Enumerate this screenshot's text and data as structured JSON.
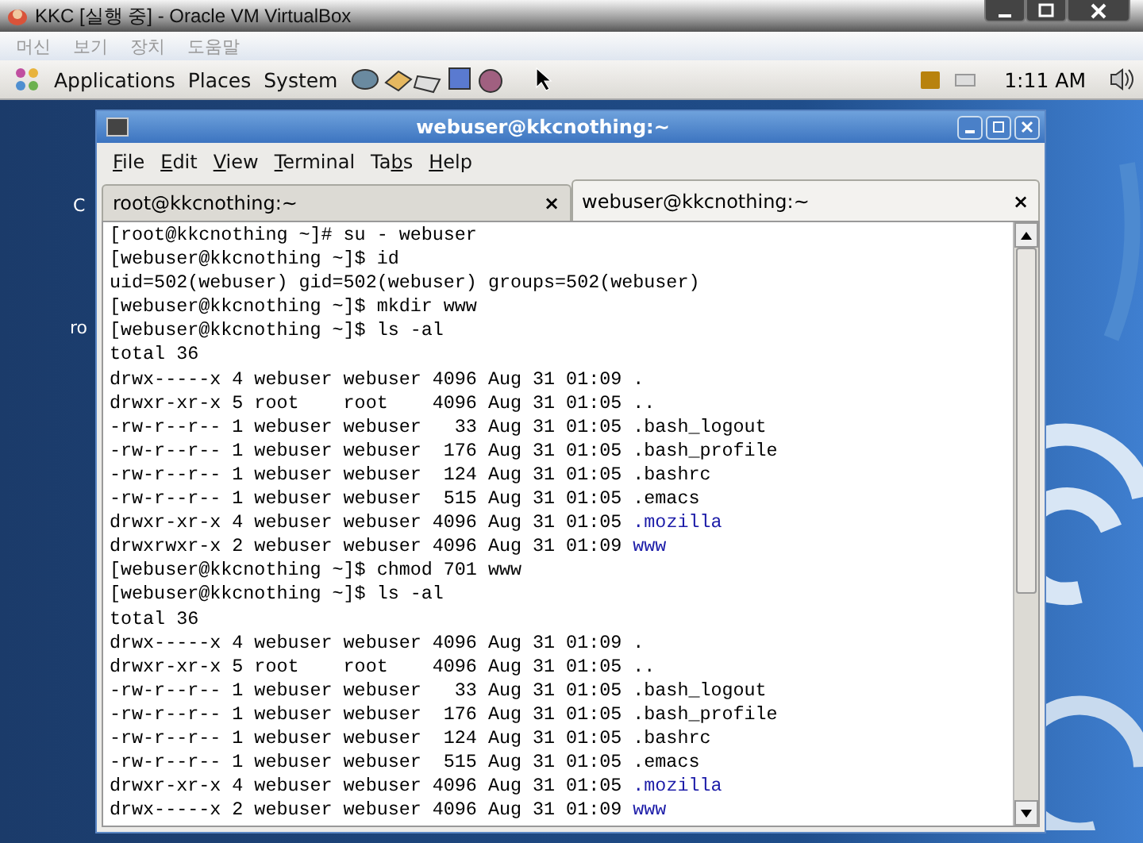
{
  "host_window": {
    "title": "KKC [실행 중] - Oracle VM VirtualBox",
    "menu": [
      "머신",
      "보기",
      "장치",
      "도움말"
    ]
  },
  "panel": {
    "menus": [
      "Applications",
      "Places",
      "System"
    ],
    "clock": "1:11 AM"
  },
  "desktop_labels": [
    "C",
    "ro"
  ],
  "terminal": {
    "title": "webuser@kkcnothing:~",
    "menu": [
      {
        "key": "F",
        "rest": "ile"
      },
      {
        "key": "E",
        "rest": "dit"
      },
      {
        "key": "V",
        "rest": "iew"
      },
      {
        "key": "T",
        "rest": "erminal"
      },
      {
        "pre": "Ta",
        "key": "b",
        "rest": "s"
      },
      {
        "key": "H",
        "rest": "elp"
      }
    ],
    "tabs": [
      {
        "label": "root@kkcnothing:~",
        "close": "×",
        "selected": false
      },
      {
        "label": "webuser@kkcnothing:~",
        "close": "×",
        "selected": true
      }
    ],
    "lines": [
      {
        "text": "[root@kkcnothing ~]# su - webuser"
      },
      {
        "text": "[webuser@kkcnothing ~]$ id"
      },
      {
        "text": "uid=502(webuser) gid=502(webuser) groups=502(webuser)"
      },
      {
        "text": "[webuser@kkcnothing ~]$ mkdir www"
      },
      {
        "text": "[webuser@kkcnothing ~]$ ls -al"
      },
      {
        "text": "total 36"
      },
      {
        "text": "drwx-----x 4 webuser webuser 4096 Aug 31 01:09 ."
      },
      {
        "text": "drwxr-xr-x 5 root    root    4096 Aug 31 01:05 .."
      },
      {
        "text": "-rw-r--r-- 1 webuser webuser   33 Aug 31 01:05 .bash_logout"
      },
      {
        "text": "-rw-r--r-- 1 webuser webuser  176 Aug 31 01:05 .bash_profile"
      },
      {
        "text": "-rw-r--r-- 1 webuser webuser  124 Aug 31 01:05 .bashrc"
      },
      {
        "text": "-rw-r--r-- 1 webuser webuser  515 Aug 31 01:05 .emacs"
      },
      {
        "text": "drwxr-xr-x 4 webuser webuser 4096 Aug 31 01:05 ",
        "entry": ".mozilla",
        "color": "#1c1ca8"
      },
      {
        "text": "drwxrwxr-x 2 webuser webuser 4096 Aug 31 01:09 ",
        "entry": "www",
        "color": "#1c1ca8"
      },
      {
        "text": "[webuser@kkcnothing ~]$ chmod 701 www"
      },
      {
        "text": "[webuser@kkcnothing ~]$ ls -al"
      },
      {
        "text": "total 36"
      },
      {
        "text": "drwx-----x 4 webuser webuser 4096 Aug 31 01:09 ."
      },
      {
        "text": "drwxr-xr-x 5 root    root    4096 Aug 31 01:05 .."
      },
      {
        "text": "-rw-r--r-- 1 webuser webuser   33 Aug 31 01:05 .bash_logout"
      },
      {
        "text": "-rw-r--r-- 1 webuser webuser  176 Aug 31 01:05 .bash_profile"
      },
      {
        "text": "-rw-r--r-- 1 webuser webuser  124 Aug 31 01:05 .bashrc"
      },
      {
        "text": "-rw-r--r-- 1 webuser webuser  515 Aug 31 01:05 .emacs"
      },
      {
        "text": "drwxr-xr-x 4 webuser webuser 4096 Aug 31 01:05 ",
        "entry": ".mozilla",
        "color": "#1c1ca8"
      },
      {
        "text": "drwx-----x 2 webuser webuser 4096 Aug 31 01:09 ",
        "entry": "www",
        "color": "#1c1ca8"
      }
    ]
  }
}
